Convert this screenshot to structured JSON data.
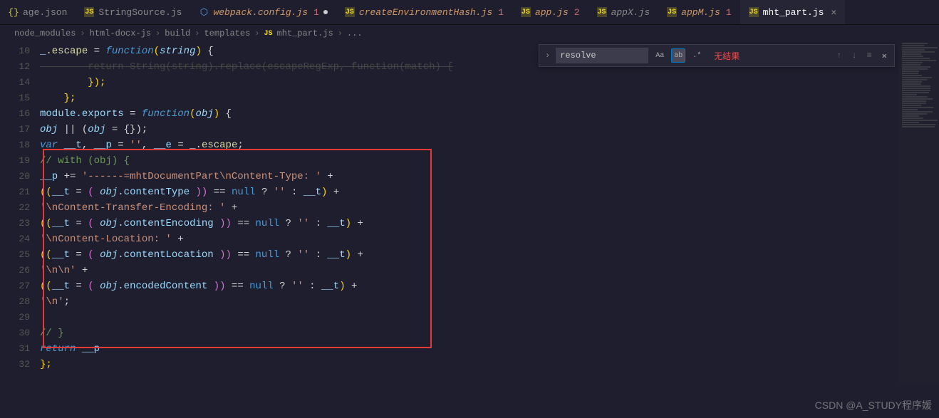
{
  "tabs": [
    {
      "icon": "{}",
      "label": "age.json",
      "badge": "",
      "close": false
    },
    {
      "icon": "JS",
      "label": "StringSource.js",
      "badge": "",
      "close": false
    },
    {
      "icon": "⬡",
      "label": "webpack.config.js",
      "badge": "1",
      "dot": true,
      "italic": true,
      "color": "#d19a66"
    },
    {
      "icon": "JS",
      "label": "createEnvironmentHash.js",
      "badge": "1",
      "italic": true,
      "color": "#d19a66"
    },
    {
      "icon": "JS",
      "label": "app.js",
      "badge": "2",
      "italic": true,
      "color": "#d19a66"
    },
    {
      "icon": "JS",
      "label": "appX.js",
      "badge": "",
      "italic": true
    },
    {
      "icon": "JS",
      "label": "appM.js",
      "badge": "1",
      "italic": true,
      "color": "#d19a66"
    },
    {
      "icon": "JS",
      "label": "mht_part.js",
      "active": true,
      "close": true
    }
  ],
  "breadcrumbs": [
    "node_modules",
    "html-docx-js",
    "build",
    "templates",
    "mht_part.js",
    "..."
  ],
  "breadcrumb_icon": "JS",
  "find": {
    "query": "resolve",
    "match_case": "Aa",
    "whole_word": "ab",
    "regex": ".*",
    "no_results": "无结果"
  },
  "watermark": "CSDN @A_STUDY程序媛",
  "lines": {
    "start": 10,
    "end": 32
  },
  "code": {
    "l10": {
      "pre": "_",
      "fn": ".escape",
      "op1": " = ",
      "kw": "function",
      "p1": "(",
      "param": "string",
      "p2": ")",
      "brace": " {"
    },
    "l12_raw": "        return String(string).replace(escapeRegExp, function(match) {",
    "l14": {
      "indent": "        ",
      "brace": "});"
    },
    "l15": {
      "indent": "    ",
      "brace": "};"
    },
    "l16": {
      "var1": "module",
      "prop": ".exports",
      "op": " = ",
      "kw": "function",
      "p1": "(",
      "param": "obj",
      "p2": ")",
      "brace": " {"
    },
    "l17": {
      "var1": "obj",
      "op1": " || (",
      "var2": "obj",
      "op2": " = {});"
    },
    "l18": {
      "kw": "var",
      "v1": " __t",
      "c1": ", ",
      "v2": "__p",
      "op": " = ",
      "s": "''",
      "c2": ", ",
      "v3": "__e",
      "op2": " = _.",
      "fn": "escape",
      "semi": ";"
    },
    "l19": {
      "comment": "// with (obj) {"
    },
    "l20": {
      "v": "__p",
      "op": " += ",
      "s": "'------=mhtDocumentPart\\nContent-Type: '",
      "plus": " +"
    },
    "l21": {
      "p1": "((",
      "v": "__t",
      "eq": " = ",
      "p2": "( ",
      "obj": "obj",
      "prop": ".contentType",
      "p3": " ))",
      "op": " == ",
      "null": "null",
      "q": " ? ",
      "s": "''",
      "colon": " : ",
      "v2": "__t",
      "p4": ")",
      "plus": " +"
    },
    "l22": {
      "s": "'\\nContent-Transfer-Encoding: '",
      "plus": " +"
    },
    "l23": {
      "p1": "((",
      "v": "__t",
      "eq": " = ",
      "p2": "( ",
      "obj": "obj",
      "prop": ".contentEncoding",
      "p3": " ))",
      "op": " == ",
      "null": "null",
      "q": " ? ",
      "s": "''",
      "colon": " : ",
      "v2": "__t",
      "p4": ")",
      "plus": " +"
    },
    "l24": {
      "s": "'\\nContent-Location: '",
      "plus": " +"
    },
    "l25": {
      "p1": "((",
      "v": "__t",
      "eq": " = ",
      "p2": "( ",
      "obj": "obj",
      "prop": ".contentLocation",
      "p3": " ))",
      "op": " == ",
      "null": "null",
      "q": " ? ",
      "s": "''",
      "colon": " : ",
      "v2": "__t",
      "p4": ")",
      "plus": " +"
    },
    "l26": {
      "s": "'\\n\\n'",
      "plus": " +"
    },
    "l27": {
      "p1": "((",
      "v": "__t",
      "eq": " = ",
      "p2": "( ",
      "obj": "obj",
      "prop": ".encodedContent",
      "p3": " ))",
      "op": " == ",
      "null": "null",
      "q": " ? ",
      "s": "''",
      "colon": " : ",
      "v2": "__t",
      "p4": ")",
      "plus": " +"
    },
    "l28": {
      "s": "'\\n'",
      "semi": ";"
    },
    "l30": {
      "comment": "// }"
    },
    "l31": {
      "kw": "return",
      "v": " __p"
    },
    "l32": {
      "brace": "};"
    }
  }
}
